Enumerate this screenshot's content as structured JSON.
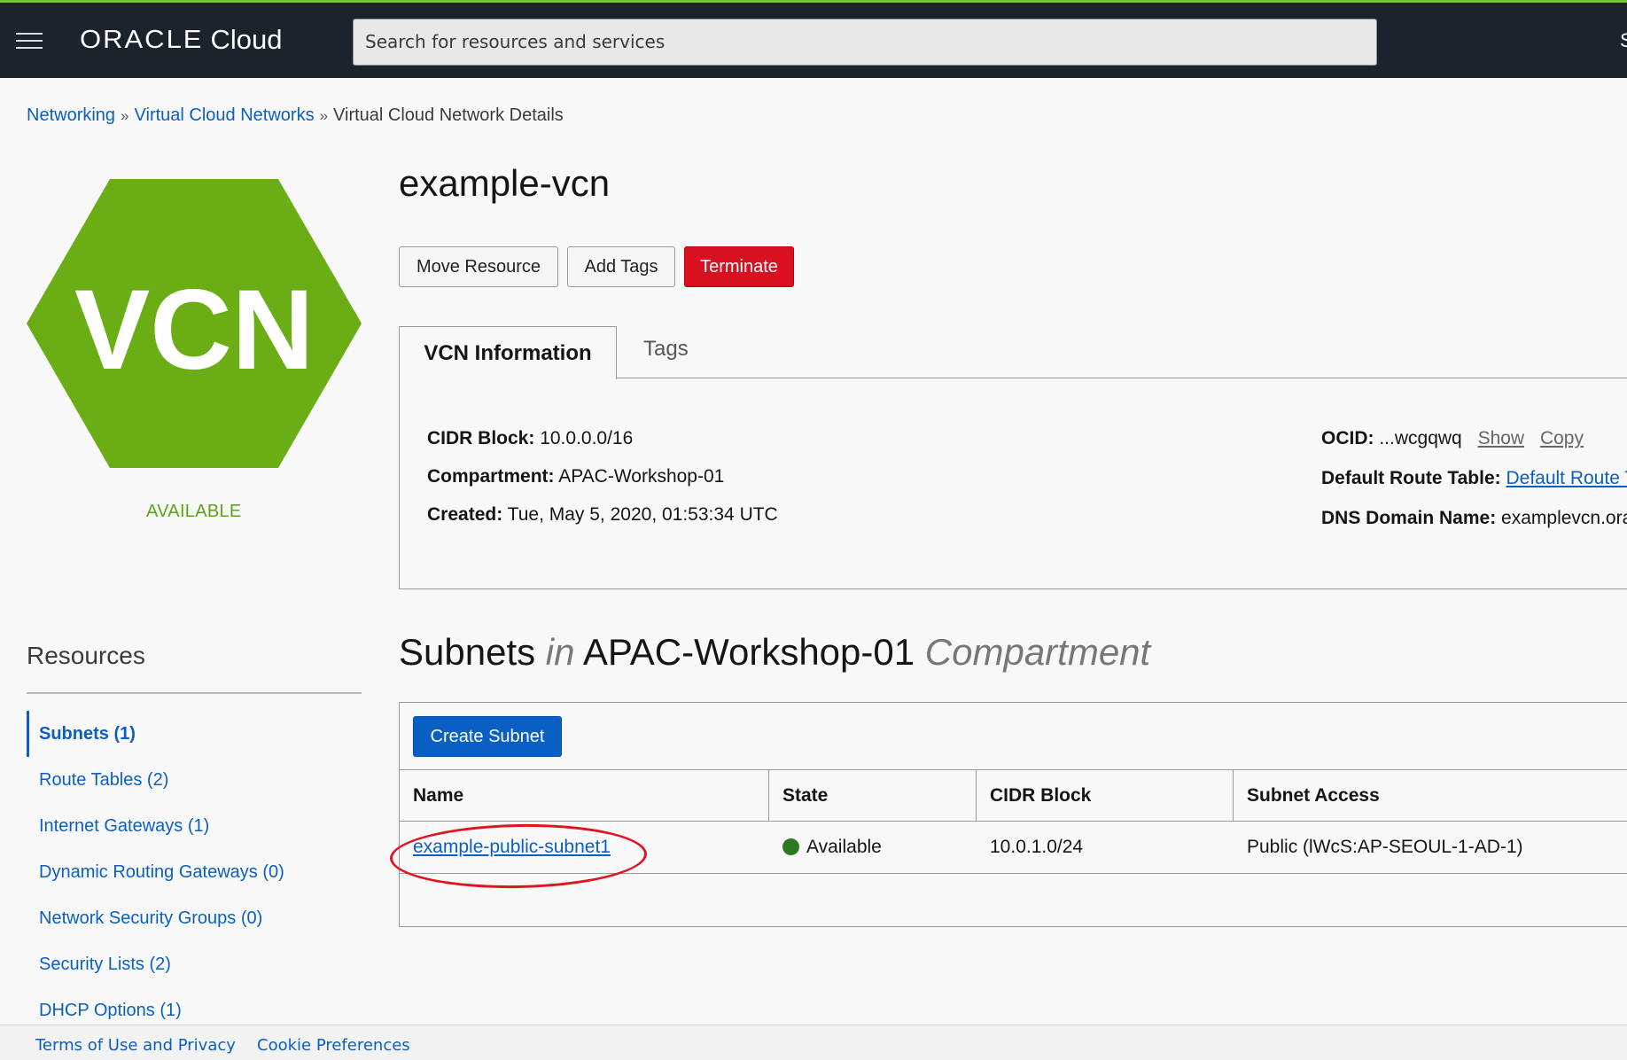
{
  "header": {
    "brand_oracle": "ORACLE",
    "brand_cloud": "Cloud",
    "search_placeholder": "Search for resources and services",
    "edge_char": "S"
  },
  "breadcrumb": {
    "items": [
      "Networking",
      "Virtual Cloud Networks"
    ],
    "separator": "»",
    "current": "Virtual Cloud Network Details"
  },
  "resource": {
    "icon_text": "VCN",
    "icon_color": "#6aad14",
    "status": "AVAILABLE",
    "status_color": "#5aa514",
    "title": "example-vcn"
  },
  "actions": {
    "move": "Move Resource",
    "add_tags": "Add Tags",
    "terminate": "Terminate"
  },
  "tabs": [
    {
      "label": "VCN Information",
      "active": true
    },
    {
      "label": "Tags",
      "active": false
    }
  ],
  "info": {
    "cidr_label": "CIDR Block:",
    "cidr_value": "10.0.0.0/16",
    "compartment_label": "Compartment:",
    "compartment_value": "APAC-Workshop-01",
    "created_label": "Created:",
    "created_value": "Tue, May 5, 2020, 01:53:34 UTC",
    "ocid_label": "OCID:",
    "ocid_value": "...wcgqwq",
    "ocid_show": "Show",
    "ocid_copy": "Copy",
    "route_label": "Default Route Table:",
    "route_value": "Default Route T",
    "dns_label": "DNS Domain Name:",
    "dns_value": "examplevcn.ora"
  },
  "sidebar": {
    "title": "Resources",
    "items": [
      {
        "label": "Subnets (1)",
        "active": true
      },
      {
        "label": "Route Tables (2)",
        "active": false
      },
      {
        "label": "Internet Gateways (1)",
        "active": false
      },
      {
        "label": "Dynamic Routing Gateways (0)",
        "active": false
      },
      {
        "label": "Network Security Groups (0)",
        "active": false
      },
      {
        "label": "Security Lists (2)",
        "active": false
      },
      {
        "label": "DHCP Options (1)",
        "active": false
      }
    ]
  },
  "subnets": {
    "heading_main": "Subnets",
    "heading_in": "in",
    "heading_compartment": "APAC-Workshop-01",
    "heading_suffix": "Compartment",
    "create_button": "Create Subnet",
    "columns": [
      "Name",
      "State",
      "CIDR Block",
      "Subnet Access"
    ],
    "rows": [
      {
        "name": "example-public-subnet1",
        "state": "Available",
        "state_color": "#2c7a1f",
        "cidr": "10.0.1.0/24",
        "access": "Public (lWcS:AP-SEOUL-1-AD-1)"
      }
    ],
    "highlight_color": "#e0141d"
  },
  "footer": {
    "terms": "Terms of Use and Privacy",
    "cookies": "Cookie Preferences"
  }
}
